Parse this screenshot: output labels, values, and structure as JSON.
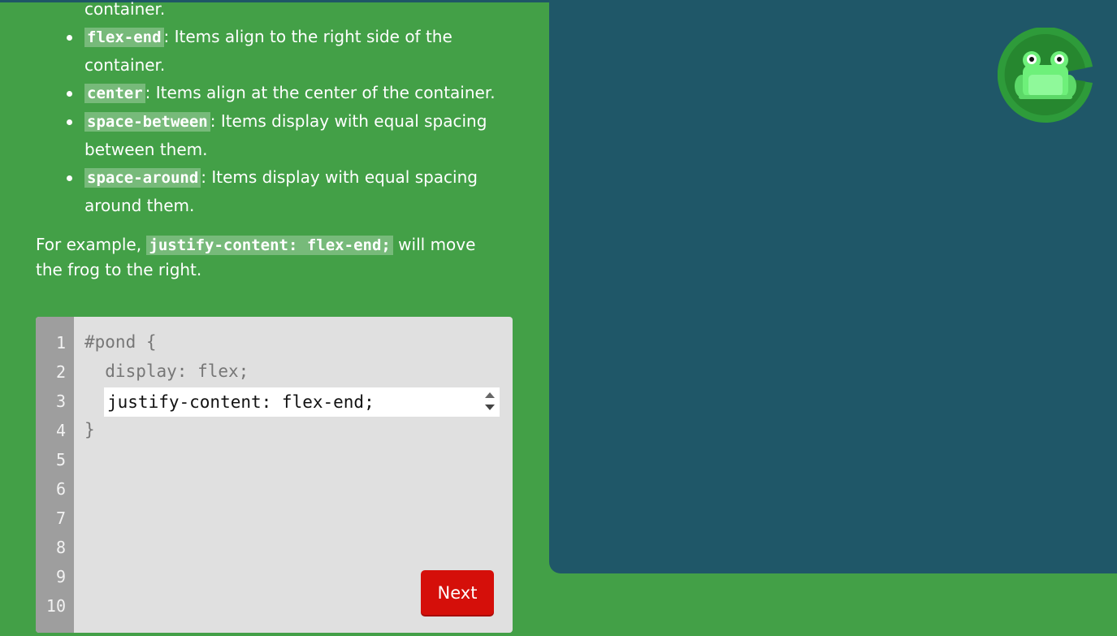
{
  "instructions": {
    "bullets": [
      {
        "continuation": "container."
      },
      {
        "code": "flex-end",
        "text": ": Items align to the right side of the",
        "text2": "container."
      },
      {
        "code": "center",
        "text": ": Items align at the center of the container."
      },
      {
        "code": "space-between",
        "text": ": Items display with equal spacing",
        "text2": "between them."
      },
      {
        "code": "space-around",
        "text": ": Items display with equal spacing",
        "text2": "around them."
      }
    ],
    "example": {
      "prefix": "For example, ",
      "code": "justify-content: flex-end;",
      "suffix": " will move",
      "line2": "the frog to the right."
    }
  },
  "editor": {
    "line_numbers": [
      "1",
      "2",
      "3",
      "4",
      "5",
      "6",
      "7",
      "8",
      "9",
      "10"
    ],
    "line1": "#pond {",
    "line2": "  display: flex;",
    "input_value": "justify-content: flex-end;",
    "line4": "}",
    "next_label": "Next"
  },
  "colors": {
    "background": "#43a047",
    "pond": "#1f5768",
    "editor_bg": "#e0e0e0",
    "gutter": "#9e9e9e",
    "next_button": "#d50f0a",
    "frog": "#6ef07a",
    "lilypad": "#2e9b3a"
  },
  "icons": {
    "frog": "frog-icon",
    "lilypad": "lilypad-icon"
  }
}
